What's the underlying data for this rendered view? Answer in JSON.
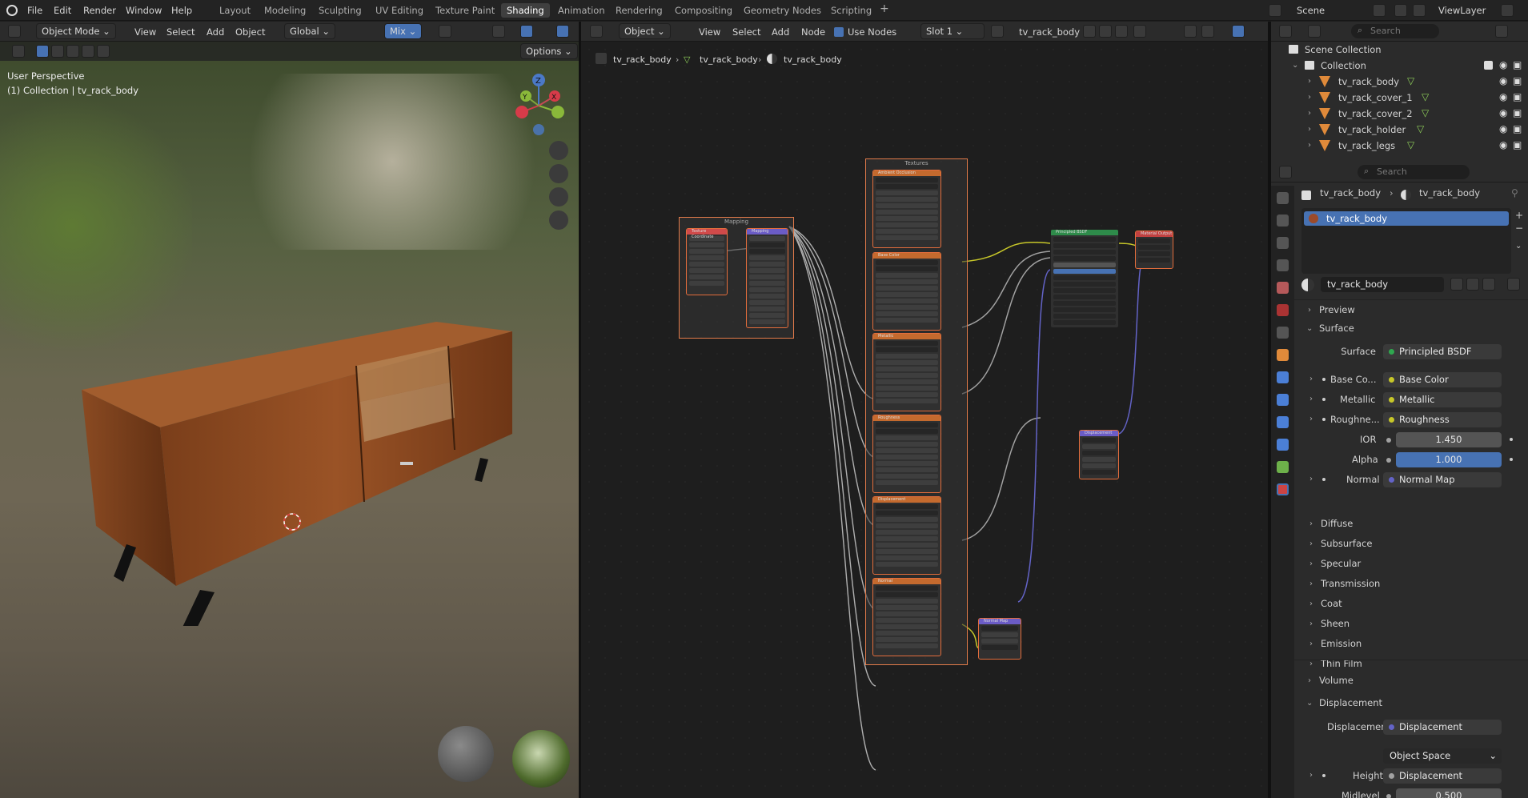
{
  "menu": {
    "file": "File",
    "edit": "Edit",
    "render": "Render",
    "window": "Window",
    "help": "Help"
  },
  "workspaces": [
    "Layout",
    "Modeling",
    "Sculpting",
    "UV Editing",
    "Texture Paint",
    "Shading",
    "Animation",
    "Rendering",
    "Compositing",
    "Geometry Nodes",
    "Scripting"
  ],
  "active_workspace": "Shading",
  "add_workspace": "+",
  "scene": {
    "label": "Scene",
    "view_layer": "ViewLayer"
  },
  "viewport": {
    "mode": "Object Mode",
    "view": "View",
    "select": "Select",
    "add": "Add",
    "object": "Object",
    "orientation": "Global",
    "shading": "Mix",
    "options": "Options",
    "perspective": "User Perspective",
    "collection_info": "(1) Collection | tv_rack_body",
    "axis_x": "X",
    "axis_y": "Y",
    "axis_z": "Z"
  },
  "node_editor": {
    "type": "Object",
    "view": "View",
    "select": "Select",
    "add": "Add",
    "node": "Node",
    "use_nodes": "Use Nodes",
    "slot": "Slot 1",
    "material": "tv_rack_body",
    "breadcrumbs": [
      "tv_rack_body",
      "tv_rack_body",
      "tv_rack_body"
    ],
    "frame_mapping": "Mapping",
    "frame_textures": "Textures",
    "nodes": {
      "tex_coord": "Texture Coordinate",
      "mapping": "Mapping",
      "ao": "Ambient Occlusion",
      "base_color": "Base Color",
      "metallic": "Metallic",
      "roughness": "Roughness",
      "displacement_tex": "Displacement",
      "normal_tex": "Normal",
      "bsdf": "Principled BSDF",
      "output": "Material Output",
      "displacement": "Displacement",
      "normal_map": "Normal Map"
    }
  },
  "outliner": {
    "search": "Search",
    "scene_collection": "Scene Collection",
    "collection": "Collection",
    "items": [
      "tv_rack_body",
      "tv_rack_cover_1",
      "tv_rack_cover_2",
      "tv_rack_holder",
      "tv_rack_legs"
    ]
  },
  "properties": {
    "search": "Search",
    "breadcrumb_object": "tv_rack_body",
    "breadcrumb_material": "tv_rack_body",
    "slot_item": "tv_rack_body",
    "material_name": "tv_rack_body",
    "preview": "Preview",
    "surface_section": "Surface",
    "surface_label": "Surface",
    "surface_value": "Principled BSDF",
    "base_color_label": "Base Co...",
    "base_color_value": "Base Color",
    "metallic_label": "Metallic",
    "metallic_value": "Metallic",
    "roughness_label": "Roughne...",
    "roughness_value": "Roughness",
    "ior_label": "IOR",
    "ior_value": "1.450",
    "alpha_label": "Alpha",
    "alpha_value": "1.000",
    "normal_label": "Normal",
    "normal_value": "Normal Map",
    "subpanels": [
      "Diffuse",
      "Subsurface",
      "Specular",
      "Transmission",
      "Coat",
      "Sheen",
      "Emission",
      "Thin Film"
    ],
    "volume": "Volume",
    "displacement_section": "Displacement",
    "disp_label": "Displacement",
    "disp_value": "Displacement",
    "space_value": "Object Space",
    "height_label": "Height",
    "height_value": "Displacement",
    "midlevel_label": "Midlevel",
    "midlevel_value": "0.500"
  },
  "colors": {
    "accent": "#4772b3",
    "frame_border": "#e37b4a",
    "socket_yellow": "#c7c729",
    "socket_gray": "#a1a1a1",
    "socket_purple": "#6363c7"
  }
}
